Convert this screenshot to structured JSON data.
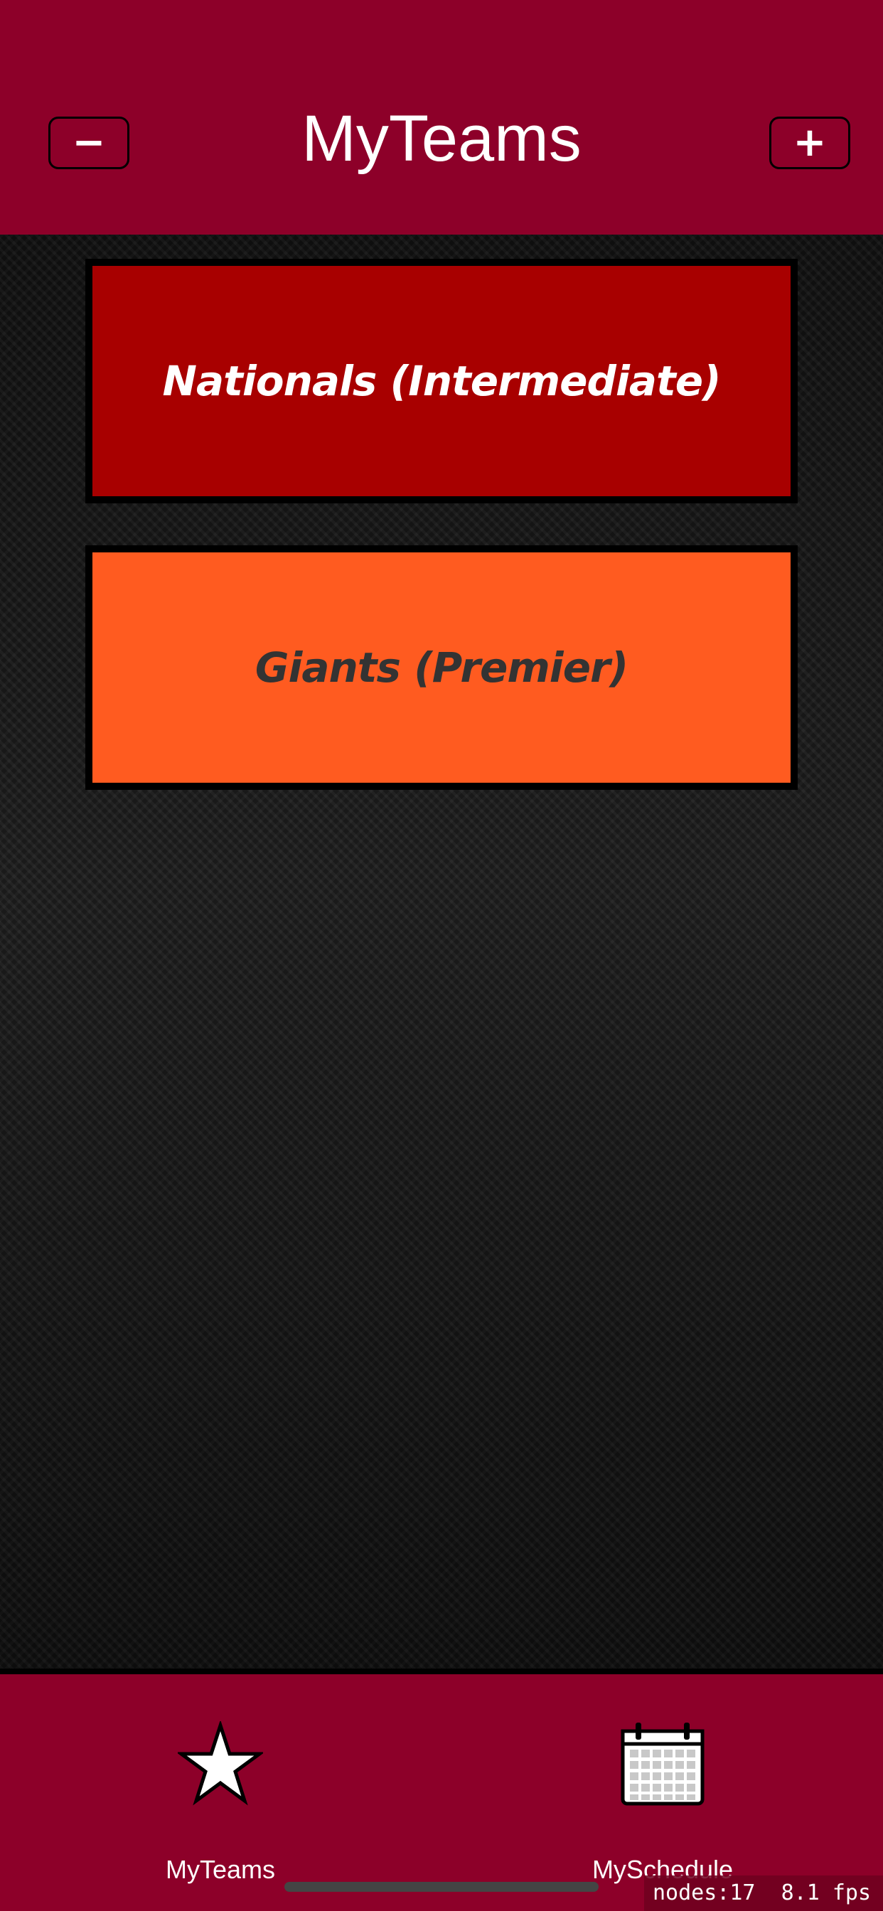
{
  "header": {
    "title": "MyTeams",
    "remove_button_label": "−",
    "add_button_label": "+"
  },
  "teams": [
    {
      "name": "Nationals (Intermediate)",
      "color": "#a80000",
      "text_color": "#ffffff"
    },
    {
      "name": "Giants (Premier)",
      "color": "#ff5b20",
      "text_color": "#333333"
    }
  ],
  "tabbar": {
    "items": [
      {
        "label": "MyTeams",
        "icon": "star-icon",
        "active": true
      },
      {
        "label": "MySchedule",
        "icon": "calendar-icon",
        "active": false
      }
    ]
  },
  "debug": {
    "stats": "nodes:17  8.1 fps"
  },
  "colors": {
    "brand": "#8d0029",
    "background": "#111111"
  }
}
